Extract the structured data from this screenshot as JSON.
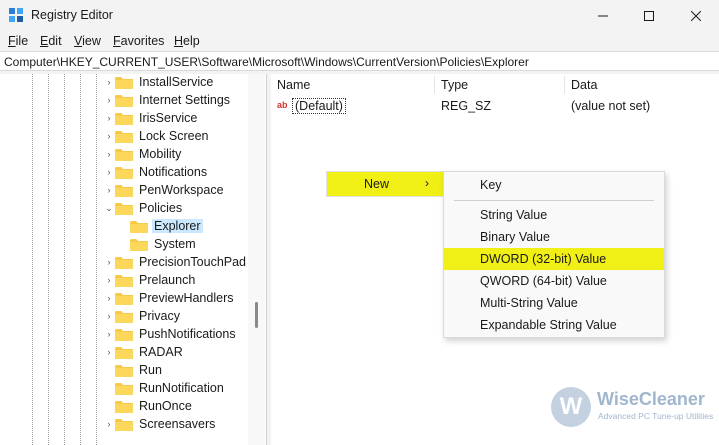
{
  "window": {
    "title": "Registry Editor"
  },
  "menu": [
    {
      "label": "File",
      "accel": "F",
      "rest": "ile"
    },
    {
      "label": "Edit",
      "accel": "E",
      "rest": "dit"
    },
    {
      "label": "View",
      "accel": "V",
      "rest": "iew"
    },
    {
      "label": "Favorites",
      "accel": "F",
      "rest": "avorites"
    },
    {
      "label": "Help",
      "accel": "H",
      "rest": "elp"
    }
  ],
  "address": "Computer\\HKEY_CURRENT_USER\\Software\\Microsoft\\Windows\\CurrentVersion\\Policies\\Explorer",
  "tree": [
    {
      "label": "InstallService",
      "expander": "›"
    },
    {
      "label": "Internet Settings",
      "expander": "›"
    },
    {
      "label": "IrisService",
      "expander": "›"
    },
    {
      "label": "Lock Screen",
      "expander": "›"
    },
    {
      "label": "Mobility",
      "expander": "›"
    },
    {
      "label": "Notifications",
      "expander": "›"
    },
    {
      "label": "PenWorkspace",
      "expander": "›"
    },
    {
      "label": "Policies",
      "expander": "⌄"
    },
    {
      "label": "Explorer",
      "expander": "",
      "selected": true,
      "child": true
    },
    {
      "label": "System",
      "expander": "",
      "child": true
    },
    {
      "label": "PrecisionTouchPad",
      "expander": "›"
    },
    {
      "label": "Prelaunch",
      "expander": "›"
    },
    {
      "label": "PreviewHandlers",
      "expander": "›"
    },
    {
      "label": "Privacy",
      "expander": "›"
    },
    {
      "label": "PushNotifications",
      "expander": "›"
    },
    {
      "label": "RADAR",
      "expander": "›"
    },
    {
      "label": "Run",
      "expander": ""
    },
    {
      "label": "RunNotification",
      "expander": ""
    },
    {
      "label": "RunOnce",
      "expander": ""
    },
    {
      "label": "Screensavers",
      "expander": "›"
    }
  ],
  "columns": {
    "name": "Name",
    "type": "Type",
    "data": "Data"
  },
  "values": [
    {
      "name": "(Default)",
      "type": "REG_SZ",
      "data": "(value not set)"
    }
  ],
  "context_menu": {
    "new_label": "New",
    "arrow": "›",
    "submenu": [
      {
        "label": "Key"
      },
      {
        "label": "String Value"
      },
      {
        "label": "Binary Value"
      },
      {
        "label": "DWORD (32-bit) Value",
        "highlighted": true
      },
      {
        "label": "QWORD (64-bit) Value"
      },
      {
        "label": "Multi-String Value"
      },
      {
        "label": "Expandable String Value"
      }
    ]
  },
  "watermark": {
    "letter": "W",
    "name": "WiseCleaner",
    "tagline": "Advanced PC Tune-up Utilities"
  },
  "colors": {
    "highlight": "#f0ef16",
    "selection": "#cce8ff",
    "folder": "#f7c948"
  }
}
